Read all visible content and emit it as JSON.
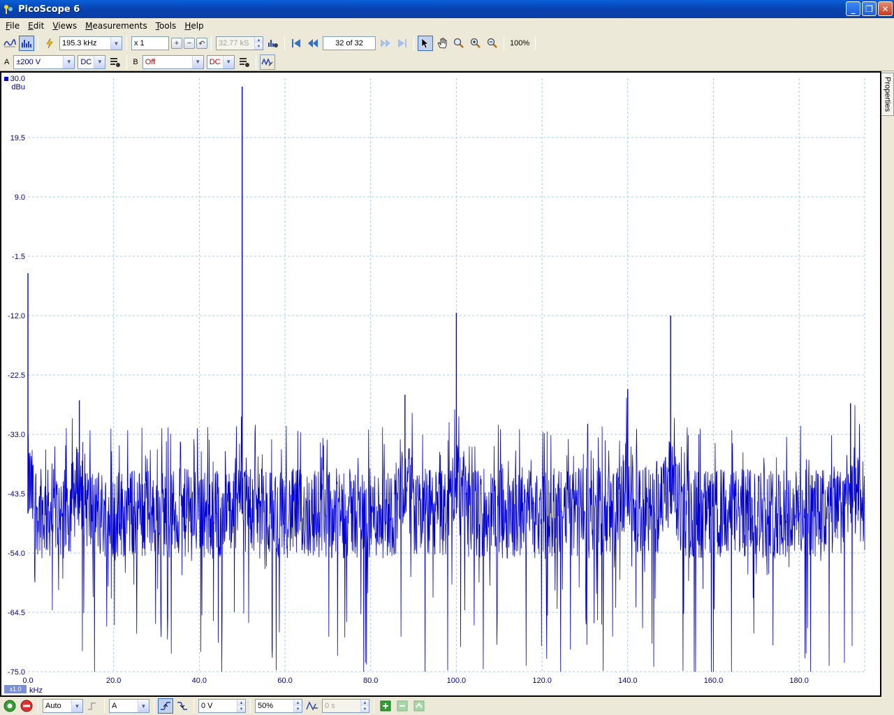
{
  "window": {
    "title": "PicoScope 6"
  },
  "menu": {
    "items": [
      {
        "u": "F",
        "rest": "ile"
      },
      {
        "u": "E",
        "rest": "dit"
      },
      {
        "u": "V",
        "rest": "iews"
      },
      {
        "u": "M",
        "rest": "easurements"
      },
      {
        "u": "T",
        "rest": "ools"
      },
      {
        "u": "H",
        "rest": "elp"
      }
    ]
  },
  "toolbar": {
    "span": "195.3 kHz",
    "zoom_factor": "x 1",
    "samples": "32.77 kS",
    "buffer": "32 of 32",
    "zoom_percent": "100%"
  },
  "channels": {
    "a_label": "A",
    "a_range": "±200 V",
    "a_coupling": "DC",
    "b_label": "B",
    "b_range": "Off",
    "b_coupling": "DC"
  },
  "bottom": {
    "trigger_mode": "Auto",
    "trigger_source": "A",
    "threshold": "0 V",
    "pre_trigger": "50%",
    "delay": "0 s"
  },
  "properties_tab": "Properties",
  "colors": {
    "trace": "#0000dd",
    "grid": "#a8c8e0"
  },
  "chart_data": {
    "type": "line",
    "xlabel": "kHz",
    "ylabel": "dBu",
    "x_scale_badge": "x1.0",
    "xlim": [
      0,
      195.3
    ],
    "ylim": [
      -75.0,
      30.0
    ],
    "x_ticks": [
      "0.0",
      "20.0",
      "40.0",
      "60.0",
      "80.0",
      "100.0",
      "120.0",
      "140.0",
      "160.0",
      "180.0"
    ],
    "y_ticks": [
      "30.0",
      "19.5",
      "9.0",
      "-1.5",
      "-12.0",
      "-22.5",
      "-33.0",
      "-43.5",
      "-54.0",
      "-64.5",
      "-75.0"
    ],
    "noise_floor_dbu": -47,
    "peaks": [
      {
        "x": 0.0,
        "y": -4.5
      },
      {
        "x": 50.0,
        "y": 28.5
      },
      {
        "x": 100.0,
        "y": -11.5
      },
      {
        "x": 150.0,
        "y": -12.0
      },
      {
        "x": 140.0,
        "y": -25.0
      },
      {
        "x": 88.0,
        "y": -26.0
      },
      {
        "x": 12.0,
        "y": -27.0
      },
      {
        "x": 192.0,
        "y": -27.5
      }
    ]
  }
}
